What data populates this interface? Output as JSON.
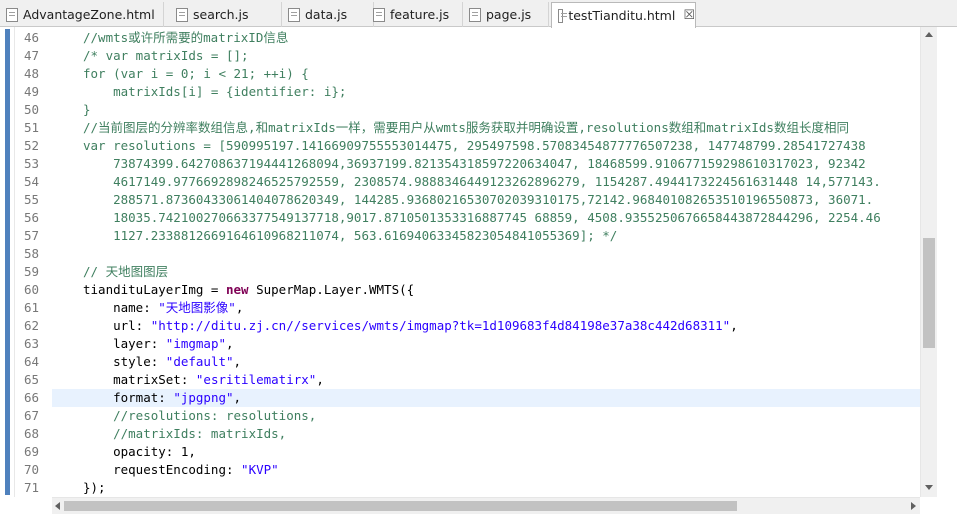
{
  "tabs": [
    {
      "label": "AdvantageZone.html",
      "active": false
    },
    {
      "label": "search.js",
      "active": false
    },
    {
      "label": "data.js",
      "active": false
    },
    {
      "label": "feature.js",
      "active": false
    },
    {
      "label": "page.js",
      "active": false
    },
    {
      "label": "testTianditu.html",
      "active": true
    }
  ],
  "close_glyph": "☒",
  "editor": {
    "highlighted_line": 66,
    "lines": [
      {
        "num": "46",
        "parts": [
          [
            "c",
            "//wmts或许所需要的matrixID信息"
          ]
        ]
      },
      {
        "num": "47",
        "parts": [
          [
            "c",
            "/* var matrixIds = [];"
          ]
        ]
      },
      {
        "num": "48",
        "parts": [
          [
            "c",
            "for (var i = 0; i < 21; ++i) {"
          ]
        ]
      },
      {
        "num": "49",
        "parts": [
          [
            "c",
            "    matrixIds[i] = {identifier: i};"
          ]
        ]
      },
      {
        "num": "50",
        "parts": [
          [
            "c",
            "}"
          ]
        ]
      },
      {
        "num": "51",
        "parts": [
          [
            "c",
            "//当前图层的分辨率数组信息,和matrixIds一样，需要用户从wmts服务获取并明确设置,resolutions数组和matrixIds数组长度相同"
          ]
        ]
      },
      {
        "num": "52",
        "parts": [
          [
            "c",
            "var resolutions = [590995197.14166909755553014475, 295497598.57083454877776507238, 147748799.28541727438"
          ]
        ]
      },
      {
        "num": "53",
        "parts": [
          [
            "c",
            "    73874399.642708637194441268094,36937199.821354318597220634047, 18468599.910677159298610317023, 92342"
          ]
        ]
      },
      {
        "num": "54",
        "parts": [
          [
            "c",
            "    4617149.9776692898246525792559, 2308574.9888346449123262896279, 1154287.4944173224561631448 14,577143."
          ]
        ]
      },
      {
        "num": "55",
        "parts": [
          [
            "c",
            "    288571.87360433061404078620349, 144285.93680216530702039310175,72142.968401082653510196550873, 36071."
          ]
        ]
      },
      {
        "num": "56",
        "parts": [
          [
            "c",
            "    18035.742100270663377549137718,9017.8710501353316887745 68859, 4508.9355250676658443872844296, 2254.46"
          ]
        ]
      },
      {
        "num": "57",
        "parts": [
          [
            "c",
            "    1127.2338812669164610968211074, 563.61694063345823054841055369]; */"
          ]
        ]
      },
      {
        "num": "58",
        "parts": []
      },
      {
        "num": "59",
        "parts": [
          [
            "c",
            "// 天地图图层"
          ]
        ]
      },
      {
        "num": "60",
        "parts": [
          [
            "p",
            "tiandituLayerImg = "
          ],
          [
            "k",
            "new"
          ],
          [
            "p",
            " SuperMap.Layer.WMTS({"
          ]
        ]
      },
      {
        "num": "61",
        "parts": [
          [
            "p",
            "    name: "
          ],
          [
            "s",
            "\"天地图影像\""
          ],
          [
            "p",
            ","
          ]
        ]
      },
      {
        "num": "62",
        "parts": [
          [
            "p",
            "    url: "
          ],
          [
            "s",
            "\"http://ditu.zj.cn//services/wmts/imgmap?tk=1d109683f4d84198e37a38c442d68311\""
          ],
          [
            "p",
            ","
          ]
        ]
      },
      {
        "num": "63",
        "parts": [
          [
            "p",
            "    layer: "
          ],
          [
            "s",
            "\"imgmap\""
          ],
          [
            "p",
            ","
          ]
        ]
      },
      {
        "num": "64",
        "parts": [
          [
            "p",
            "    style: "
          ],
          [
            "s",
            "\"default\""
          ],
          [
            "p",
            ","
          ]
        ]
      },
      {
        "num": "65",
        "parts": [
          [
            "p",
            "    matrixSet: "
          ],
          [
            "s",
            "\"esritilematirx\""
          ],
          [
            "p",
            ","
          ]
        ]
      },
      {
        "num": "66",
        "parts": [
          [
            "p",
            "    format: "
          ],
          [
            "s",
            "\"jpgpng\""
          ],
          [
            "p",
            ","
          ]
        ]
      },
      {
        "num": "67",
        "parts": [
          [
            "c",
            "    //resolutions: resolutions,"
          ]
        ]
      },
      {
        "num": "68",
        "parts": [
          [
            "c",
            "    //matrixIds: matrixIds,"
          ]
        ]
      },
      {
        "num": "69",
        "parts": [
          [
            "p",
            "    opacity: 1,"
          ]
        ]
      },
      {
        "num": "70",
        "parts": [
          [
            "p",
            "    requestEncoding: "
          ],
          [
            "s",
            "\"KVP\""
          ]
        ]
      },
      {
        "num": "71",
        "parts": [
          [
            "p",
            "});"
          ]
        ]
      }
    ]
  },
  "colors": {
    "comment": "#3f7f5f",
    "keyword": "#7f0055",
    "string": "#2a00ff",
    "highlight": "#e8f2fe",
    "change_bar": "#4f81bd"
  }
}
